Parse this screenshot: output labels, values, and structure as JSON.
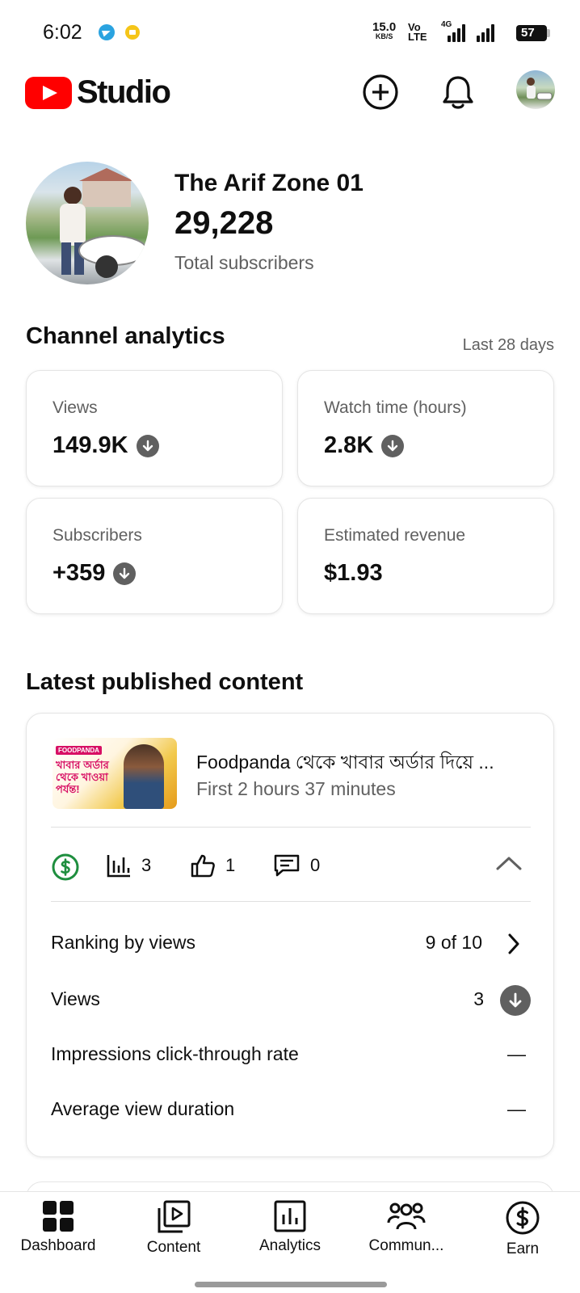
{
  "status_bar": {
    "time": "6:02",
    "speed_value": "15.0",
    "speed_unit": "KB/S",
    "volte_top": "Vo",
    "volte_bottom": "LTE",
    "network": "4G",
    "battery": "57"
  },
  "header": {
    "logo_text": "Studio",
    "brand_color": "#ff0000",
    "create_icon": "plus-circle-icon",
    "notifications_icon": "bell-icon",
    "account_icon": "avatar"
  },
  "channel": {
    "name": "The Arif Zone 01",
    "subscribers": "29,228",
    "subscribers_label": "Total subscribers"
  },
  "analytics": {
    "title": "Channel analytics",
    "period": "Last 28 days",
    "cards": [
      {
        "label": "Views",
        "value": "149.9K",
        "trend": "down"
      },
      {
        "label": "Watch time (hours)",
        "value": "2.8K",
        "trend": "down"
      },
      {
        "label": "Subscribers",
        "value": "+359",
        "trend": "down"
      },
      {
        "label": "Estimated revenue",
        "value": "$1.93",
        "trend": "none"
      }
    ]
  },
  "latest": {
    "title": "Latest published content",
    "video": {
      "title": "Foodpanda থেকে খাবার অর্ডার দিয়ে ...",
      "subtitle": "First 2 hours 37 minutes",
      "thumb_badge": "FOODPANDA",
      "thumb_text": "খাবার অর্ডার থেকে খাওয়া পর্যন্ত!"
    },
    "metrics": {
      "monetization_icon": "dollar-circle-icon",
      "views": "3",
      "likes": "1",
      "comments": "0"
    },
    "rows": [
      {
        "label": "Ranking by views",
        "value": "9 of 10"
      },
      {
        "label": "Views",
        "value": "3"
      },
      {
        "label": "Impressions click-through rate",
        "value": "—"
      },
      {
        "label": "Average view duration",
        "value": "—"
      }
    ],
    "monetization_color": "#1e8e3e"
  },
  "nav": {
    "items": [
      {
        "label": "Dashboard",
        "icon": "dashboard-icon"
      },
      {
        "label": "Content",
        "icon": "content-icon"
      },
      {
        "label": "Analytics",
        "icon": "analytics-icon"
      },
      {
        "label": "Commun...",
        "icon": "community-icon"
      },
      {
        "label": "Earn",
        "icon": "earn-icon"
      }
    ]
  }
}
